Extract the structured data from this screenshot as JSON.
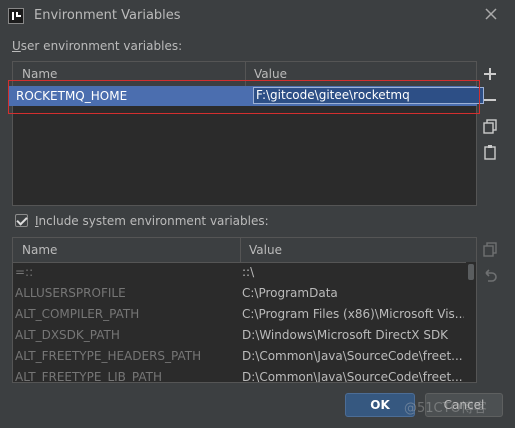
{
  "window": {
    "title": "Environment Variables"
  },
  "user_section": {
    "label_prefix": "U",
    "label_rest": "ser environment variables:",
    "columns": [
      "Name",
      "Value"
    ],
    "rows": [
      {
        "name": "ROCKETMQ_HOME",
        "value": "F:\\gitcode\\gitee\\rocketmq"
      }
    ]
  },
  "include_checkbox": {
    "label_prefix": "I",
    "label_rest": "nclude system environment variables:",
    "checked": true
  },
  "system_section": {
    "columns": [
      "Name",
      "Value"
    ],
    "rows": [
      {
        "name": "=::",
        "value": "::\\"
      },
      {
        "name": "ALLUSERSPROFILE",
        "value": "C:\\ProgramData"
      },
      {
        "name": "ALT_COMPILER_PATH",
        "value": "C:\\Program Files (x86)\\Microsoft Vis..."
      },
      {
        "name": "ALT_DXSDK_PATH",
        "value": "D:\\Windows\\Microsoft DirectX SDK"
      },
      {
        "name": "ALT_FREETYPE_HEADERS_PATH",
        "value": "D:\\Common\\Java\\SourceCode\\freet..."
      },
      {
        "name": "ALT_FREETYPE_LIB_PATH",
        "value": "D:\\Common\\Java\\SourceCode\\freet..."
      }
    ]
  },
  "buttons": {
    "ok": "OK",
    "cancel": "Cancel"
  },
  "watermark": "@51CTO博客",
  "colors": {
    "selection": "#4b6eaf",
    "highlight_box": "#d32f2f",
    "ok_button": "#365880"
  }
}
